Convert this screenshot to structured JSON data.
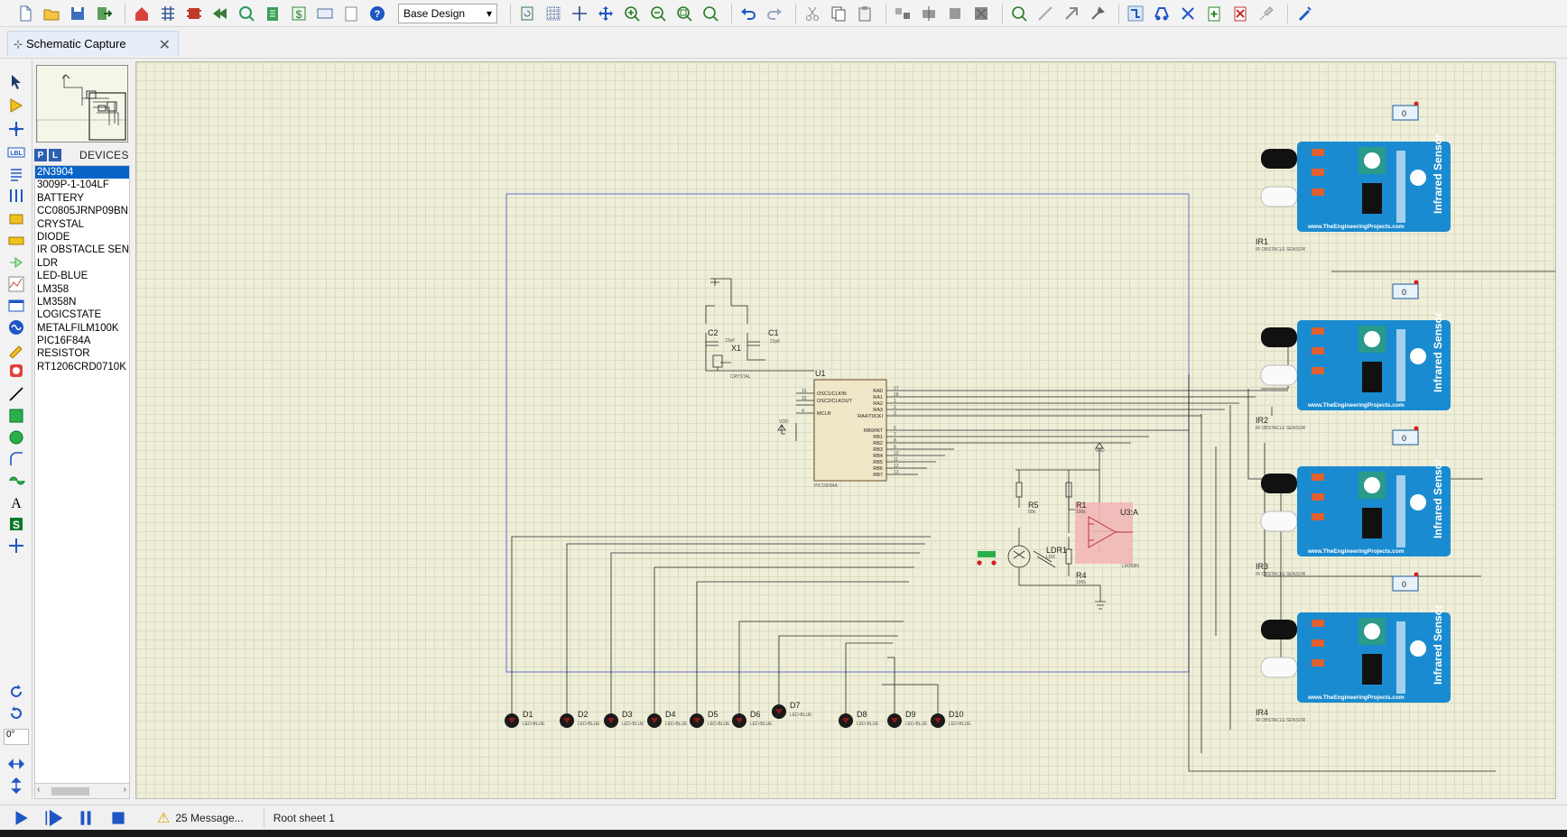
{
  "toolbar": {
    "design_select": "Base Design",
    "icons": [
      "new-icon",
      "open-icon",
      "save-icon",
      "import-icon",
      "home-icon",
      "schematic-icon",
      "pcb-icon",
      "gerber-icon",
      "search-icon",
      "bom-icon",
      "dollar-icon",
      "vsm-icon",
      "notes-icon",
      "help-icon",
      "refresh-icon",
      "grid-icon",
      "origin-icon",
      "pan-icon",
      "zoom-in-icon",
      "zoom-out-icon",
      "zoom-all-icon",
      "zoom-area-icon",
      "undo-icon",
      "redo-icon",
      "cut-icon",
      "copy-icon",
      "paste-icon",
      "block-copy-icon",
      "block-move-icon",
      "block-rotate-icon",
      "block-delete-icon",
      "pick-device-icon",
      "make-device-icon",
      "packaging-icon",
      "decompose-icon",
      "wire-autorouter-icon",
      "search-tag-icon",
      "property-tool-icon",
      "new-sheet-icon",
      "remove-sheet-icon",
      "netlist-icon"
    ]
  },
  "tab": {
    "label": "Schematic Capture"
  },
  "tools": {
    "angle": "0°"
  },
  "devices": {
    "p_button": "P",
    "l_button": "L",
    "title": "DEVICES",
    "items": [
      "2N3904",
      "3009P-1-104LF",
      "BATTERY",
      "CC0805JRNP09BN",
      "CRYSTAL",
      "DIODE",
      "IR OBSTACLE SEN",
      "LDR",
      "LED-BLUE",
      "LM358",
      "LM358N",
      "LOGICSTATE",
      "METALFILM100K",
      "PIC16F84A",
      "RESISTOR",
      "RT1206CRD0710K"
    ],
    "selected_index": 0
  },
  "schematic": {
    "u1": {
      "ref": "U1",
      "part": "PIC16F84A",
      "left_pins": [
        "OSC1/CLKIN",
        "OSC2/CLKOUT",
        "MCLR"
      ],
      "left_nums": [
        "16",
        "15",
        "4"
      ],
      "right_pins": [
        "RA0",
        "RA1",
        "RA2",
        "RA3",
        "RA4/T0CKI",
        "RB0/INT",
        "RB1",
        "RB2",
        "RB3",
        "RB4",
        "RB5",
        "RB6",
        "RB7"
      ],
      "right_nums": [
        "17",
        "18",
        "1",
        "2",
        "3",
        "6",
        "7",
        "8",
        "9",
        "10",
        "11",
        "12",
        "13"
      ]
    },
    "crystal": {
      "ref": "X1",
      "part": "CRYSTAL"
    },
    "c1": {
      "ref": "C1",
      "value": "22pF"
    },
    "c2": {
      "ref": "C2",
      "value": "22pF"
    },
    "vdd_labels": [
      "VDD",
      "VDD"
    ],
    "r5": {
      "ref": "R5",
      "value": "50k"
    },
    "r1": {
      "ref": "R1",
      "value": "100k"
    },
    "r4": {
      "ref": "R4",
      "value": "100k"
    },
    "ldr": {
      "ref": "LDR1",
      "part": "LDR"
    },
    "u3": {
      "ref": "U3:A",
      "part": "LM358N"
    },
    "leds": [
      {
        "ref": "D1",
        "part": "LED-BLUE"
      },
      {
        "ref": "D2",
        "part": "LED-BLUE"
      },
      {
        "ref": "D3",
        "part": "LED-BLUE"
      },
      {
        "ref": "D4",
        "part": "LED-BLUE"
      },
      {
        "ref": "D5",
        "part": "LED-BLUE"
      },
      {
        "ref": "D6",
        "part": "LED-BLUE"
      },
      {
        "ref": "D7",
        "part": "LED-BLUE"
      },
      {
        "ref": "D8",
        "part": "LED-BLUE"
      },
      {
        "ref": "D9",
        "part": "LED-BLUE"
      },
      {
        "ref": "D10",
        "part": "LED-BLUE"
      }
    ],
    "sensors": [
      {
        "ref": "IR1",
        "part": "IR OBSTACLE SENSOR",
        "state": "0",
        "brand": "Infrared Sensor",
        "url": "www.TheEngineeringProjects.com"
      },
      {
        "ref": "IR2",
        "part": "IR OBSTACLE SENSOR",
        "state": "0",
        "brand": "Infrared Sensor",
        "url": "www.TheEngineeringProjects.com"
      },
      {
        "ref": "IR3",
        "part": "IR OBSTACLE SENSOR",
        "state": "0",
        "brand": "Infrared Sensor",
        "url": "www.TheEngineeringProjects.com"
      },
      {
        "ref": "IR4",
        "part": "IR OBSTACLE SENSOR",
        "state": "0",
        "brand": "Infrared Sensor",
        "url": "www.TheEngineeringProjects.com"
      }
    ],
    "colors": {
      "sensor_board": "#1a8bd0",
      "selection_box": "#7d86c8",
      "led": "#1a1a1a",
      "opamp_highlight": "#f2b5b5",
      "wire": "#2a2a2a"
    }
  },
  "status": {
    "message_count": "25 Message...",
    "sheet": "Root sheet 1"
  }
}
